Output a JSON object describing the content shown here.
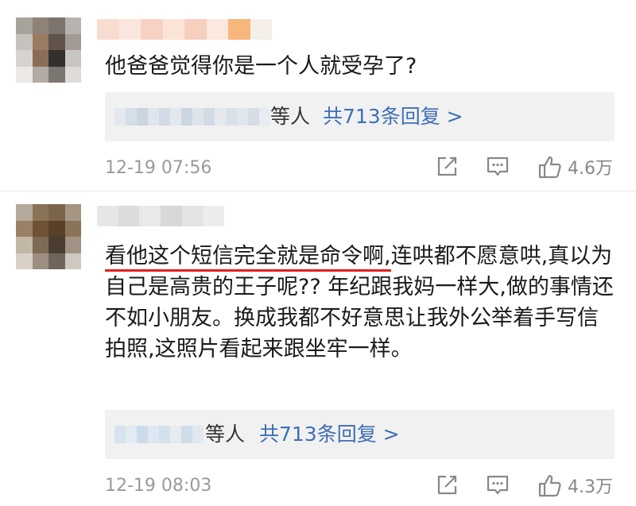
{
  "comments": [
    {
      "text": "他爸爸觉得你是一个人就受孕了?",
      "replies": {
        "suffix": "等人",
        "link": "共713条回复 >"
      },
      "timestamp": "12-19 07:56",
      "likes": "4.6万"
    },
    {
      "text_underlined": "看他这个短信完全就是命令啊,",
      "text_rest": "连哄都不愿意哄,真以为自己是高贵的王子呢?? 年纪跟我妈一样大,做的事情还不如小朋友。换成我都不好意思让我外公举着手写信拍照,这照片看起来跟坐牢一样。",
      "replies": {
        "suffix": "等人",
        "link": "共713条回复 >"
      },
      "timestamp": "12-19 08:03",
      "likes": "4.3万"
    }
  ],
  "icons": {
    "share": "share-icon",
    "comment": "comment-icon",
    "like": "thumbs-up-icon"
  },
  "colors": {
    "link": "#3e6fb8",
    "underline": "#e02020",
    "meta": "#9a9a9a",
    "reply_bg": "#f1f1f1"
  }
}
